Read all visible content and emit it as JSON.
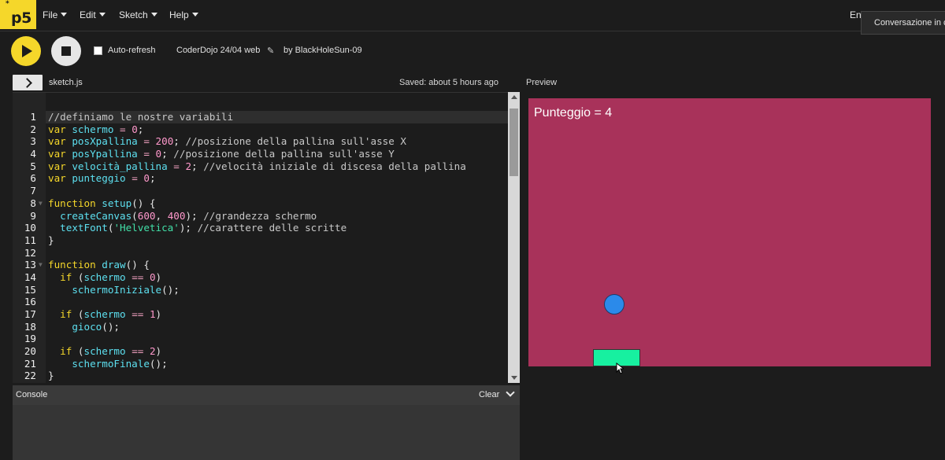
{
  "nav": {
    "logo": "p5",
    "logo_sup": "*",
    "menus": [
      "File",
      "Edit",
      "Sketch",
      "Help"
    ],
    "language": "En",
    "tooltip": "Conversazione in c"
  },
  "toolbar": {
    "auto_refresh_label": "Auto-refresh",
    "auto_refresh_checked": false,
    "project_name": "CoderDojo 24/04 web",
    "author": "by BlackHoleSun-09"
  },
  "editor": {
    "file_name": "sketch.js",
    "saved_status": "Saved: about 5 hours ago",
    "lines": [
      {
        "n": "1",
        "text": "//definiamo le nostre variabili",
        "fold": false
      },
      {
        "n": "2",
        "text": "var schermo = 0;",
        "fold": false
      },
      {
        "n": "3",
        "text": "var posXpallina = 200; //posizione della pallina sull'asse X",
        "fold": false
      },
      {
        "n": "4",
        "text": "var posYpallina = 0; //posizione della pallina sull'asse Y",
        "fold": false
      },
      {
        "n": "5",
        "text": "var velocità_pallina = 2; //velocità iniziale di discesa della pallina",
        "fold": false
      },
      {
        "n": "6",
        "text": "var punteggio = 0;",
        "fold": false
      },
      {
        "n": "7",
        "text": "",
        "fold": false
      },
      {
        "n": "8",
        "text": "function setup() {",
        "fold": true
      },
      {
        "n": "9",
        "text": "  createCanvas(600, 400); //grandezza schermo",
        "fold": false
      },
      {
        "n": "10",
        "text": "  textFont('Helvetica'); //carattere delle scritte",
        "fold": false
      },
      {
        "n": "11",
        "text": "}",
        "fold": false
      },
      {
        "n": "12",
        "text": "",
        "fold": false
      },
      {
        "n": "13",
        "text": "function draw() {",
        "fold": true
      },
      {
        "n": "14",
        "text": "  if (schermo == 0)",
        "fold": false
      },
      {
        "n": "15",
        "text": "    schermoIniziale();",
        "fold": false
      },
      {
        "n": "16",
        "text": "",
        "fold": false
      },
      {
        "n": "17",
        "text": "  if (schermo == 1)",
        "fold": false
      },
      {
        "n": "18",
        "text": "    gioco();",
        "fold": false
      },
      {
        "n": "19",
        "text": "",
        "fold": false
      },
      {
        "n": "20",
        "text": "  if (schermo == 2)",
        "fold": false
      },
      {
        "n": "21",
        "text": "    schermoFinale();",
        "fold": false
      },
      {
        "n": "22",
        "text": "}",
        "fold": false
      }
    ]
  },
  "console": {
    "title": "Console",
    "clear_label": "Clear"
  },
  "preview": {
    "label": "Preview",
    "score_text": "Punteggio = 4",
    "background_color": "#a8325a",
    "ball_color": "#2b8aea",
    "paddle_color": "#17f0a0"
  },
  "colors": {
    "accent": "#f5d72a",
    "background": "#1c1c1c"
  }
}
